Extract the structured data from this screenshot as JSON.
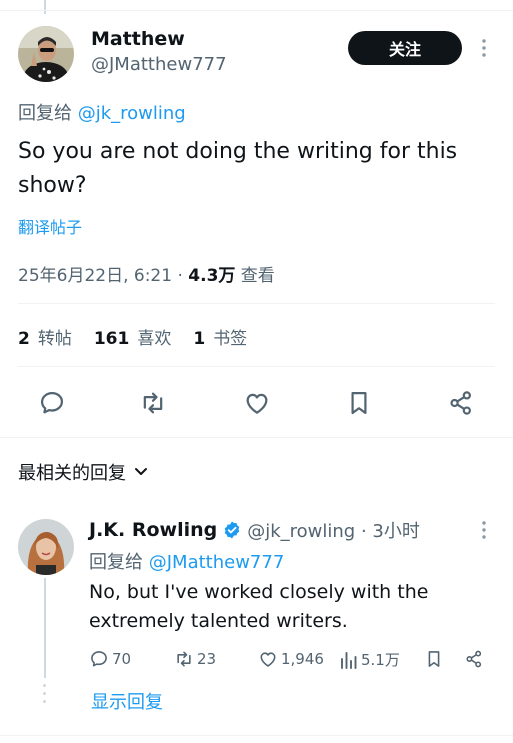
{
  "tweet": {
    "author_name": "Matthew",
    "author_handle": "@JMatthew777",
    "follow_label": "关注",
    "reply_to_prefix": "回复给 ",
    "reply_to_handle": "@jk_rowling",
    "text_line1": "So you are not doing the writing for this",
    "text_line2": "show?",
    "translate_label": "翻译帖子",
    "timestamp": "25年6月22日, 6:21 · ",
    "views_value": "4.3万",
    "views_label": " 查看",
    "reposts_count": "2",
    "reposts_label": "转帖",
    "likes_count": "161",
    "likes_label": "喜欢",
    "bookmarks_count": "1",
    "bookmarks_label": "书签"
  },
  "replies_sort": {
    "label": "最相关的回复"
  },
  "reply": {
    "author_name": "J.K. Rowling",
    "author_handle": "@jk_rowling · 3小时",
    "reply_to_prefix": "回复给 ",
    "reply_to_handle": "@JMatthew777",
    "text_line1": "No, but I've worked closely with the",
    "text_line2": "extremely talented writers.",
    "replies_count": "70",
    "reposts_count": "23",
    "likes_count": "1,946",
    "views_count": "5.1万",
    "show_replies_label": "显示回复"
  },
  "colors": {
    "accent": "#1d9bf0",
    "verified": "#1d9bf0",
    "text": "#0f1419",
    "secondary": "#536471"
  },
  "icons": [
    "reply-icon",
    "repost-icon",
    "like-icon",
    "bookmark-icon",
    "share-icon",
    "views-icon",
    "verified-icon",
    "chevron-down-icon",
    "more-icon"
  ]
}
